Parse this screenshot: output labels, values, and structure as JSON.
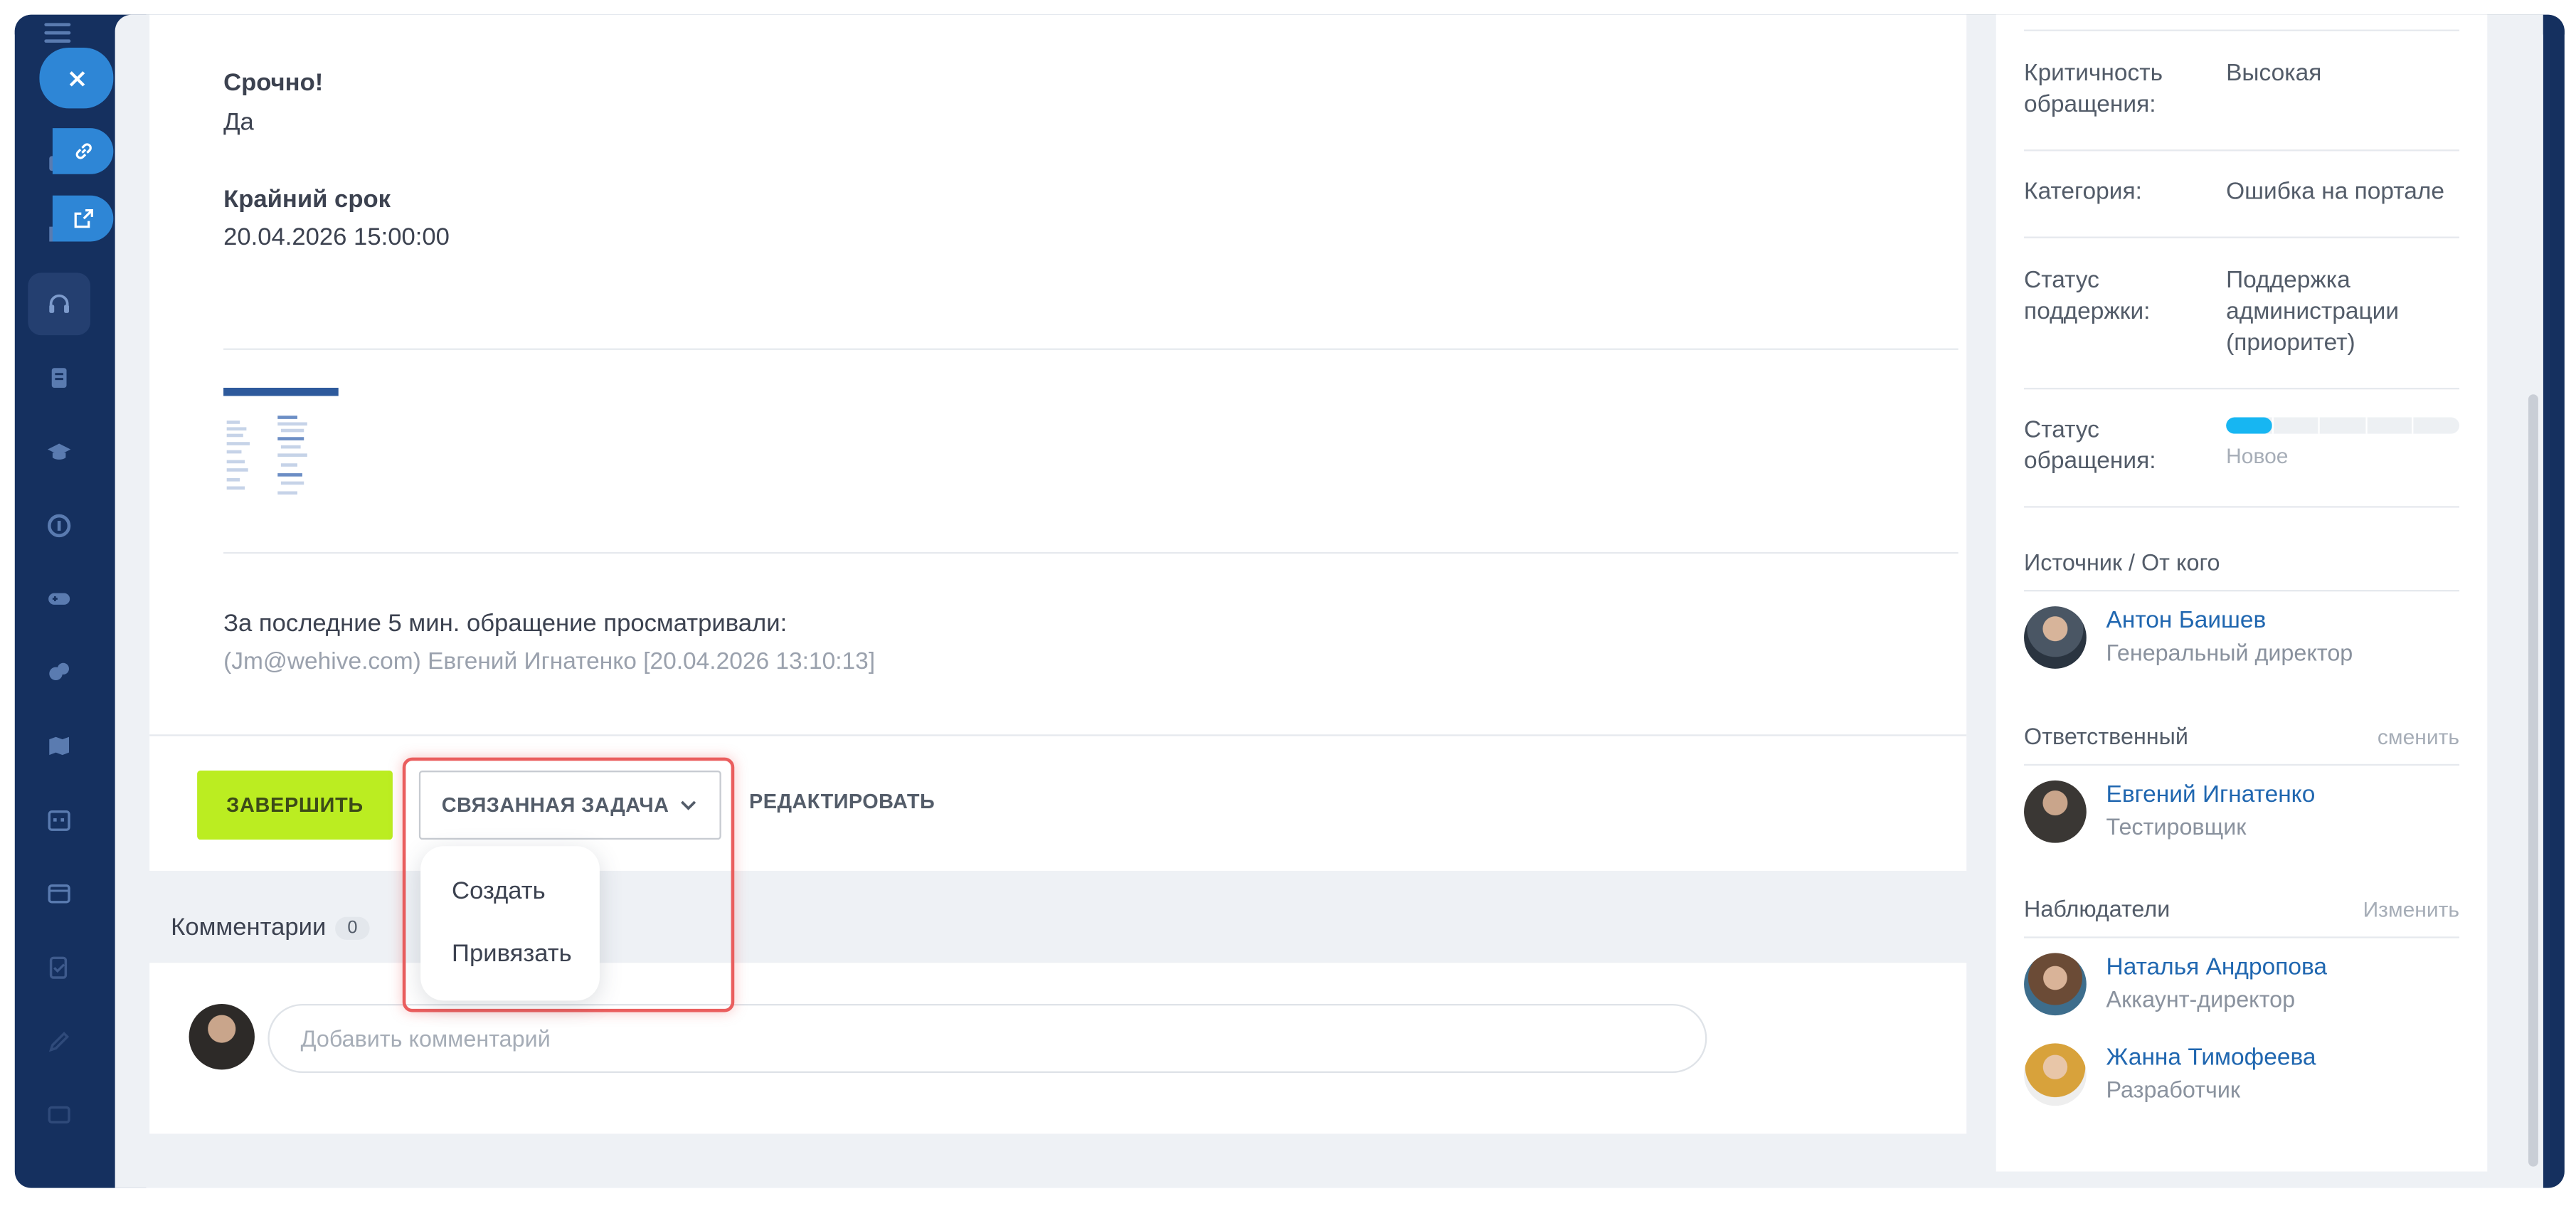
{
  "colors": {
    "sidebar": "#15305f",
    "accent_blue": "#2e86d6",
    "finish_green": "#bbed21",
    "highlight_red": "#ea5e5e",
    "progress_fill": "#17b6f2",
    "link": "#2067b0"
  },
  "sidebar": {
    "icons": [
      "menu-icon",
      "briefcase-icon",
      "folder-icon",
      "headset-icon",
      "document-icon",
      "graduation-cap-icon",
      "support-ring-icon",
      "gamepad-icon",
      "chat-bubbles-icon",
      "map-icon",
      "calendar-icon",
      "window-icon",
      "checklist-icon",
      "pen-icon",
      "message-icon"
    ],
    "floating_buttons": [
      "close-icon",
      "link-icon",
      "external-link-icon"
    ]
  },
  "ticket": {
    "urgent_title": "Срочно!",
    "urgent_value": "Да",
    "deadline_title": "Крайний срок",
    "deadline_value": "20.04.2026 15:00:00",
    "attachment": "attachment-thumbnail",
    "views_title": "За последние 5 мин. обращение просматривали:",
    "views_list": "(Jm@wehive.com) Евгений Игнатенко [20.04.2026 13:10:13]"
  },
  "actions": {
    "finish_label": "ЗАВЕРШИТЬ",
    "linked_task_label": "СВЯЗАННАЯ ЗАДАЧА",
    "edit_label": "РЕДАКТИРОВАТЬ",
    "dropdown_items": [
      "Создать",
      "Привязать"
    ]
  },
  "comments": {
    "title": "Комментарии",
    "count": "0",
    "placeholder": "Добавить комментарий"
  },
  "details": {
    "criticality_label": "Критичность обращения:",
    "criticality_value": "Высокая",
    "category_label": "Категория:",
    "category_value": "Ошибка на портале",
    "support_status_label": "Статус поддержки:",
    "support_status_value": "Поддержка администрации (приоритет)",
    "request_status_label": "Статус обращения:",
    "request_status_value": "Новое",
    "request_status_progress_percent": 20
  },
  "source": {
    "title": "Источник / От кого",
    "person": {
      "name": "Антон Баишев",
      "role": "Генеральный директор"
    }
  },
  "responsible": {
    "title": "Ответственный",
    "action": "сменить",
    "person": {
      "name": "Евгений Игнатенко",
      "role": "Тестировщик"
    }
  },
  "observers": {
    "title": "Наблюдатели",
    "action": "Изменить",
    "people": [
      {
        "name": "Наталья Андропова",
        "role": "Аккаунт-директор"
      },
      {
        "name": "Жанна Тимофеева",
        "role": "Разработчик"
      }
    ]
  }
}
